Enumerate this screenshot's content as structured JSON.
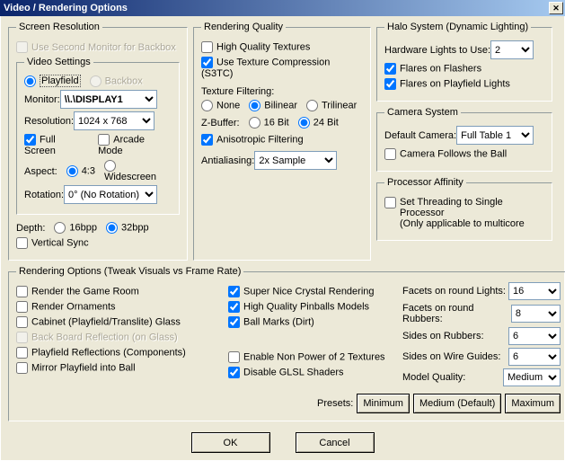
{
  "title": "Video / Rendering Options",
  "screen_resolution": {
    "legend": "Screen Resolution",
    "use_second_monitor": "Use Second Monitor for Backbox",
    "video_settings": {
      "legend": "Video Settings",
      "playfield": "Playfield",
      "backbox": "Backbox",
      "monitor_label": "Monitor:",
      "monitor_value": "\\\\.\\DISPLAY1",
      "resolution_label": "Resolution:",
      "resolution_value": "1024 x 768",
      "full_screen": "Full Screen",
      "arcade_mode": "Arcade Mode",
      "aspect_label": "Aspect:",
      "aspect_43": "4:3",
      "aspect_wide": "Widescreen",
      "rotation_label": "Rotation:",
      "rotation_value": "0° (No Rotation)"
    },
    "depth_label": "Depth:",
    "depth_16": "16bpp",
    "depth_32": "32bpp",
    "vsync": "Vertical Sync"
  },
  "rendering_quality": {
    "legend": "Rendering Quality",
    "hq_textures": "High Quality Textures",
    "texture_compression": "Use Texture Compression (S3TC)",
    "texture_filtering_label": "Texture Filtering:",
    "tf_none": "None",
    "tf_bilinear": "Bilinear",
    "tf_trilinear": "Trilinear",
    "zbuffer_label": "Z-Buffer:",
    "zb_16": "16 Bit",
    "zb_24": "24 Bit",
    "aniso": "Anisotropic Filtering",
    "aa_label": "Antialiasing:",
    "aa_value": "2x Sample"
  },
  "halo": {
    "legend": "Halo System (Dynamic Lighting)",
    "hw_lights_label": "Hardware Lights to Use:",
    "hw_lights_value": "2",
    "flares_flashers": "Flares on Flashers",
    "flares_playfield": "Flares on Playfield Lights"
  },
  "camera": {
    "legend": "Camera System",
    "default_label": "Default Camera:",
    "default_value": "Full Table 1",
    "follows_ball": "Camera Follows the Ball"
  },
  "processor": {
    "legend": "Processor Affinity",
    "set_threading": "Set Threading to Single Processor",
    "note": "(Only applicable to multicore"
  },
  "rendering_options": {
    "legend": "Rendering Options (Tweak Visuals vs Frame Rate)",
    "left": {
      "game_room": "Render the Game Room",
      "ornaments": "Render Ornaments",
      "cabinet": "Cabinet (Playfield/Translite) Glass",
      "backboard": "Back Board Reflection (on Glass)",
      "playfield_reflections": "Playfield Reflections (Components)",
      "mirror_playfield": "Mirror Playfield into Ball"
    },
    "mid": {
      "crystal": "Super Nice Crystal Rendering",
      "hq_pinballs": "High Quality Pinballs Models",
      "ball_marks": "Ball Marks (Dirt)",
      "non_power2": "Enable Non Power of 2 Textures",
      "disable_glsl": "Disable GLSL Shaders"
    },
    "right": {
      "facets_lights_label": "Facets on round Lights:",
      "facets_lights_value": "16",
      "facets_rubbers_label": "Facets on round Rubbers:",
      "facets_rubbers_value": "8",
      "sides_rubbers_label": "Sides on Rubbers:",
      "sides_rubbers_value": "6",
      "sides_wire_label": "Sides on Wire Guides:",
      "sides_wire_value": "6",
      "model_quality_label": "Model Quality:",
      "model_quality_value": "Medium"
    },
    "presets_label": "Presets:",
    "preset_min": "Minimum",
    "preset_med": "Medium (Default)",
    "preset_max": "Maximum"
  },
  "buttons": {
    "ok": "OK",
    "cancel": "Cancel"
  }
}
